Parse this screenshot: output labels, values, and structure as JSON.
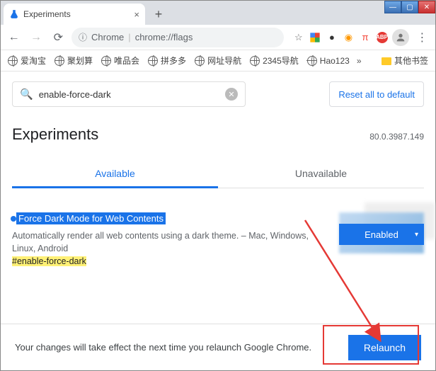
{
  "window": {
    "tab_title": "Experiments"
  },
  "omnibox": {
    "prefix": "Chrome",
    "url": "chrome://flags"
  },
  "bookmarks": {
    "items": [
      "爱淘宝",
      "聚划算",
      "唯品会",
      "拼多多",
      "网址导航",
      "2345导航",
      "Hao123"
    ],
    "overflow": "»",
    "folder": "其他书签"
  },
  "search": {
    "value": "enable-force-dark"
  },
  "reset_label": "Reset all to default",
  "page_title": "Experiments",
  "version": "80.0.3987.149",
  "tabs": {
    "available": "Available",
    "unavailable": "Unavailable"
  },
  "flag": {
    "title": "Force Dark Mode for Web Contents",
    "desc": "Automatically render all web contents using a dark theme. – Mac, Windows, Linux, Android",
    "id_prefix": "#",
    "id": "enable-force-dark",
    "state": "Enabled"
  },
  "footer": {
    "message": "Your changes will take effect the next time you relaunch Google Chrome.",
    "relaunch": "Relaunch"
  }
}
